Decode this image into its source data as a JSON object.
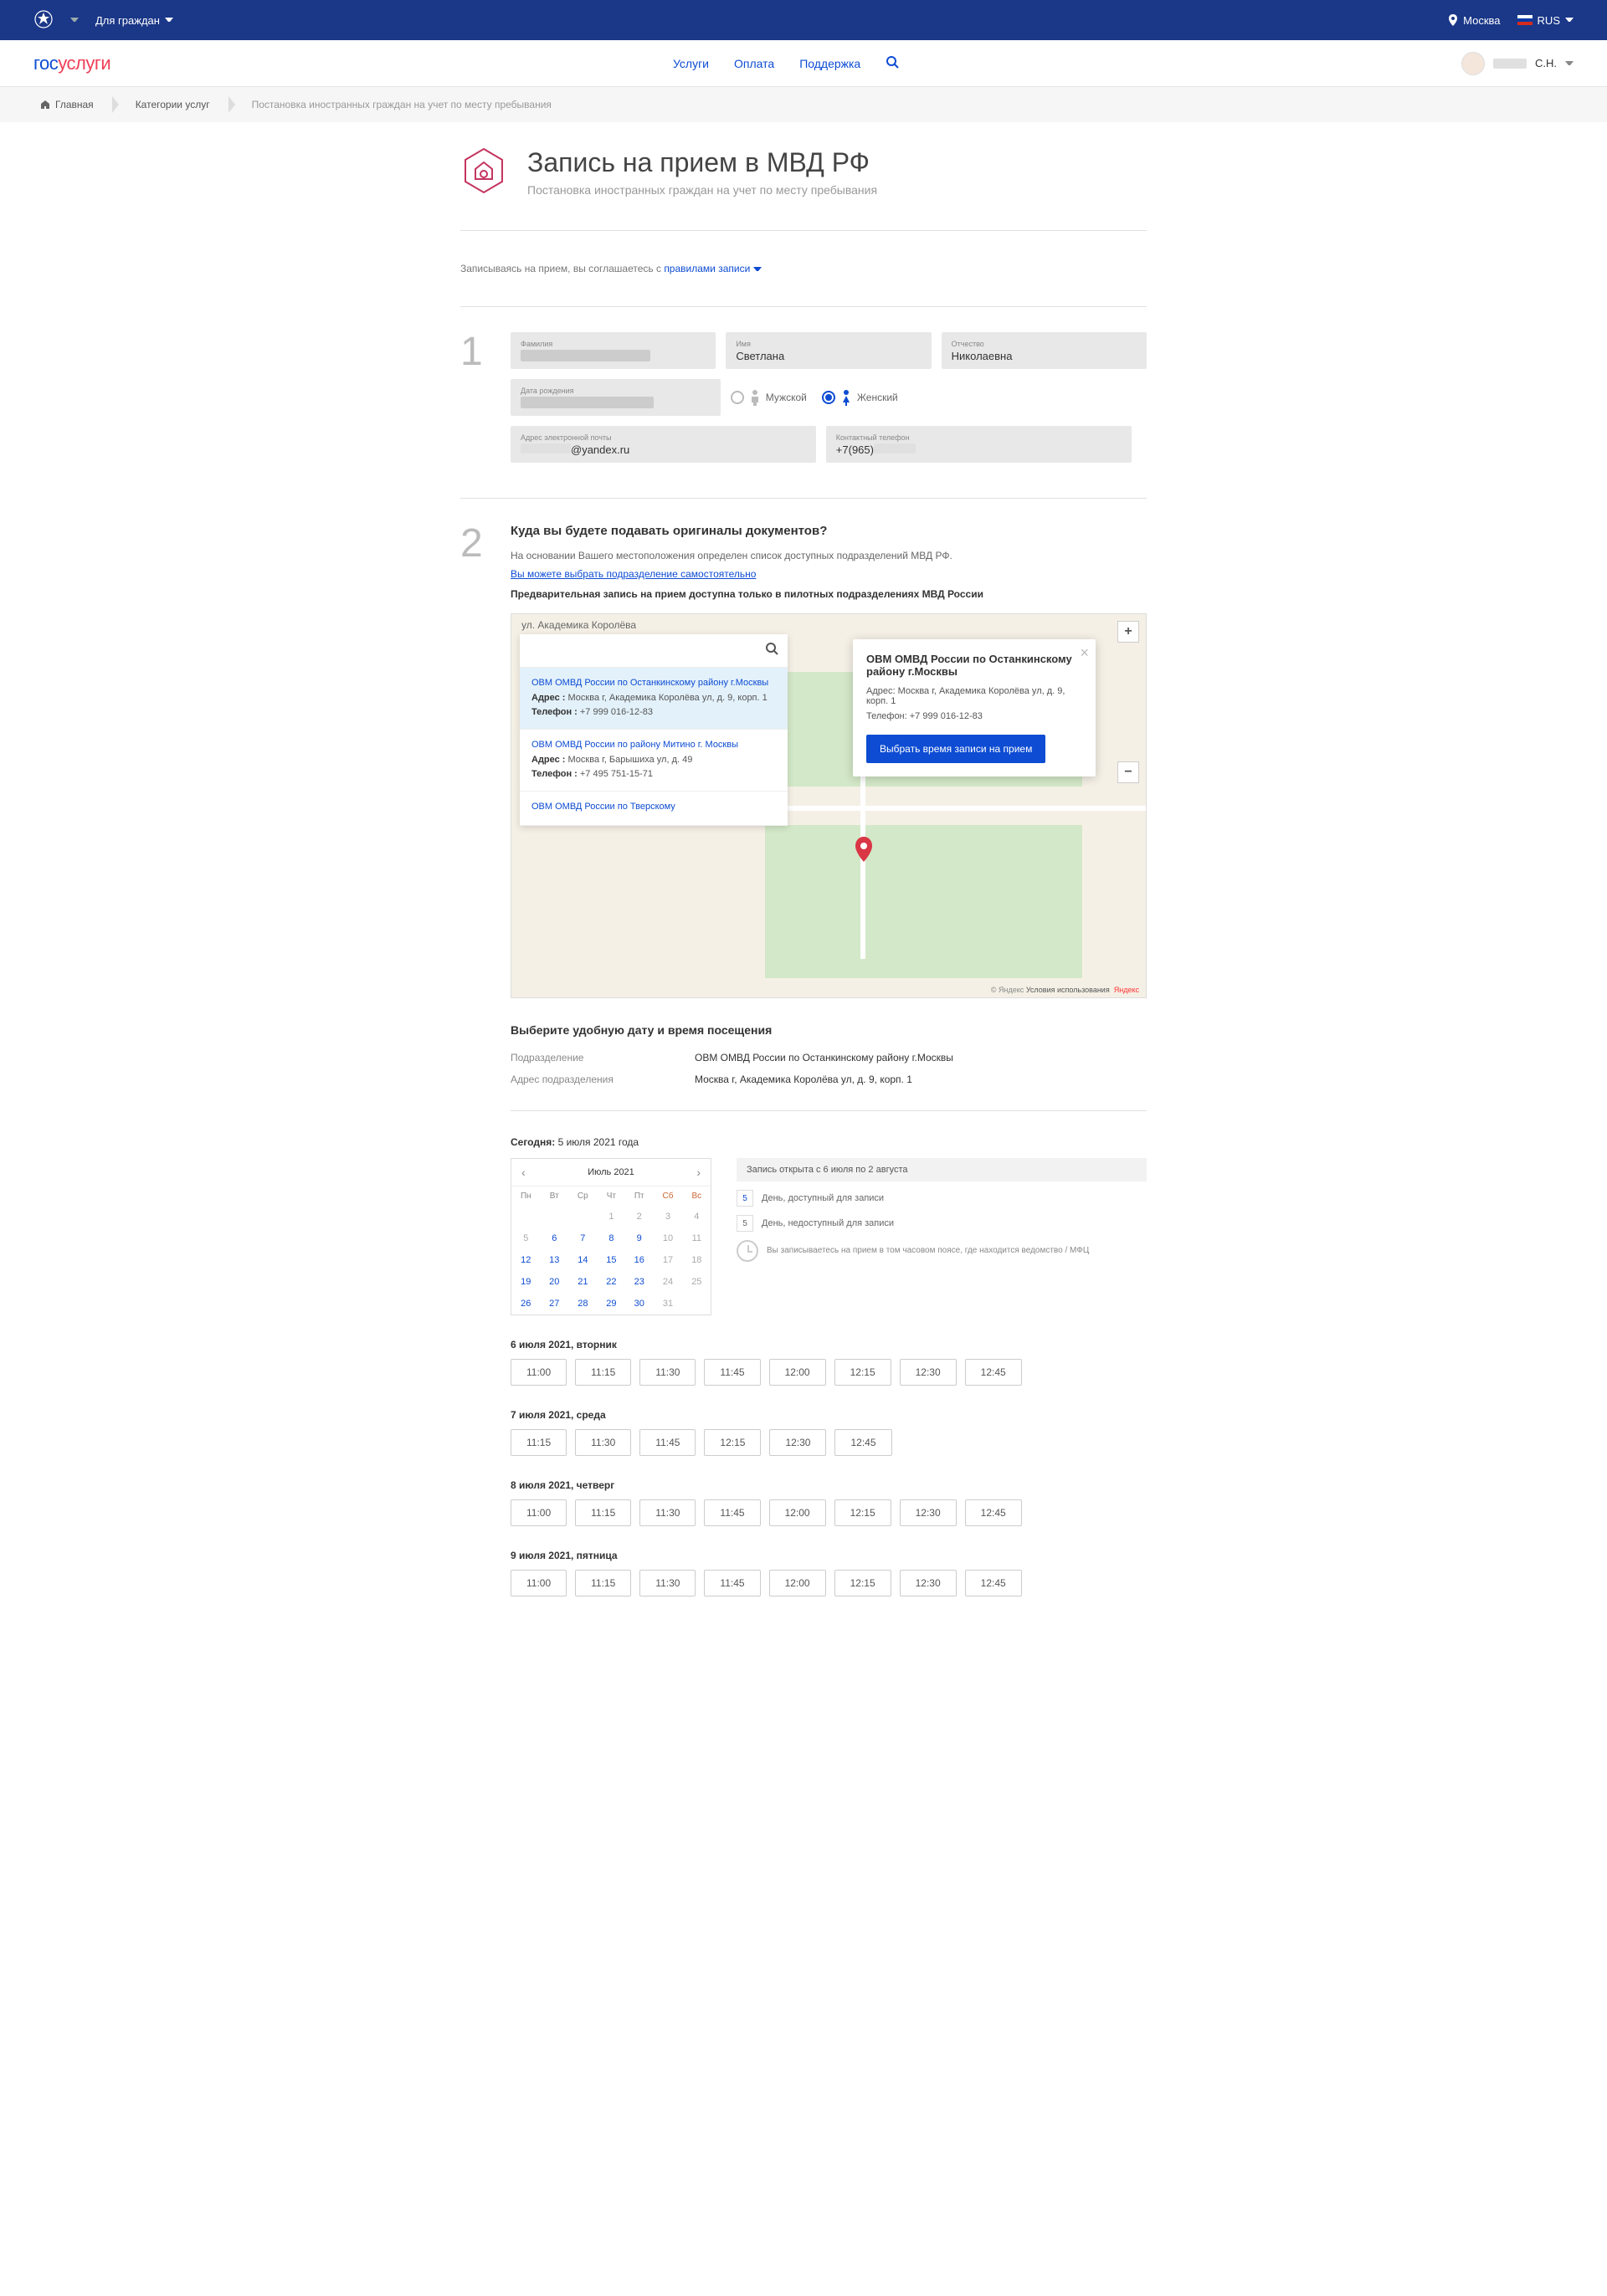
{
  "topbar": {
    "audience": "Для граждан",
    "city": "Москва",
    "lang": "RUS"
  },
  "nav": {
    "logo_a": "гос",
    "logo_b": "услуги",
    "items": [
      "Услуги",
      "Оплата",
      "Поддержка"
    ],
    "user_initials": "С.Н."
  },
  "breadcrumb": {
    "home": "Главная",
    "cat": "Категории услуг",
    "page": "Постановка иностранных граждан на учет по месту пребывания"
  },
  "head": {
    "title": "Запись на прием в МВД РФ",
    "subtitle": "Постановка иностранных граждан на учет по месту пребывания"
  },
  "rules": {
    "pre": "Записываясь на прием, вы соглашаетесь с ",
    "link": "правилами записи"
  },
  "step1": {
    "labels": {
      "surname": "Фамилия",
      "name": "Имя",
      "patronymic": "Отчество",
      "dob": "Дата рождения",
      "email": "Адрес электронной почты",
      "phone": "Контактный телефон",
      "male": "Мужской",
      "female": "Женский"
    },
    "name": "Светлана",
    "patronymic": "Николаевна",
    "email_suffix": "@yandex.ru",
    "phone_prefix": "+7(965)"
  },
  "step2": {
    "heading": "Куда вы будете подавать оригиналы документов?",
    "text1": "На основании Вашего местоположения определен список доступных подразделений МВД РФ.",
    "link": "Вы можете выбрать подразделение самостоятельно",
    "text_bold": "Предварительная запись на прием доступна только в пилотных подразделениях МВД России",
    "street": "ул. Академика Королёва",
    "offices": [
      {
        "name": "ОВМ ОМВД России по Останкинскому району г.Москвы",
        "addr": "Москва г, Академика Королёва ул, д. 9, корп. 1",
        "phone": "+7 999 016-12-83",
        "sel": true
      },
      {
        "name": "ОВМ ОМВД России по району Митино г. Москвы",
        "addr": "Москва г, Барышиха ул, д. 49",
        "phone": "+7 495 751-15-71",
        "sel": false
      },
      {
        "name": "ОВМ ОМВД России по Тверскому",
        "addr": "",
        "phone": "",
        "sel": false
      }
    ],
    "popup": {
      "title": "ОВМ ОМВД России по Останкинскому району г.Москвы",
      "addr_lbl": "Адрес: ",
      "addr": "Москва г, Академика Королёва ул, д. 9, корп. 1",
      "phone_lbl": "Телефон: ",
      "phone": "+7 999 016-12-83",
      "btn": "Выбрать время записи на прием"
    },
    "addr_word": "Адрес : ",
    "phone_word": "Телефон : ",
    "map_credit": "© Яндекс ",
    "map_terms": "Условия использования",
    "map_yandex": "Яндекс"
  },
  "selection": {
    "title": "Выберите удобную дату и время посещения",
    "dept_lbl": "Подразделение",
    "dept": "ОВМ ОМВД России по Останкинскому району г.Москвы",
    "addr_lbl": "Адрес подразделения",
    "addr": "Москва г, Академика Королёва ул, д. 9, корп. 1"
  },
  "today_lbl": "Сегодня: ",
  "today_val": "5 июля 2021 года",
  "calendar": {
    "month": "Июль 2021",
    "dow": [
      "Пн",
      "Вт",
      "Ср",
      "Чт",
      "Пт",
      "Сб",
      "Вс"
    ],
    "weeks": [
      [
        {
          "d": "",
          "a": 0
        },
        {
          "d": "",
          "a": 0
        },
        {
          "d": "",
          "a": 0
        },
        {
          "d": "1",
          "a": 0
        },
        {
          "d": "2",
          "a": 0
        },
        {
          "d": "3",
          "a": 0
        },
        {
          "d": "4",
          "a": 0
        }
      ],
      [
        {
          "d": "5",
          "a": 0
        },
        {
          "d": "6",
          "a": 1
        },
        {
          "d": "7",
          "a": 1
        },
        {
          "d": "8",
          "a": 1
        },
        {
          "d": "9",
          "a": 1
        },
        {
          "d": "10",
          "a": 0
        },
        {
          "d": "11",
          "a": 0
        }
      ],
      [
        {
          "d": "12",
          "a": 1
        },
        {
          "d": "13",
          "a": 1
        },
        {
          "d": "14",
          "a": 1
        },
        {
          "d": "15",
          "a": 1
        },
        {
          "d": "16",
          "a": 1
        },
        {
          "d": "17",
          "a": 0
        },
        {
          "d": "18",
          "a": 0
        }
      ],
      [
        {
          "d": "19",
          "a": 1
        },
        {
          "d": "20",
          "a": 1
        },
        {
          "d": "21",
          "a": 1
        },
        {
          "d": "22",
          "a": 1
        },
        {
          "d": "23",
          "a": 1
        },
        {
          "d": "24",
          "a": 0
        },
        {
          "d": "25",
          "a": 0
        }
      ],
      [
        {
          "d": "26",
          "a": 1
        },
        {
          "d": "27",
          "a": 1
        },
        {
          "d": "28",
          "a": 1
        },
        {
          "d": "29",
          "a": 1
        },
        {
          "d": "30",
          "a": 1
        },
        {
          "d": "31",
          "a": 0
        },
        {
          "d": "",
          "a": 0
        }
      ]
    ]
  },
  "legend": {
    "title": "Запись открыта с 6 июля по 2 августа",
    "avail": "День, доступный для записи",
    "navail": "День, недоступный для записи",
    "sample": "5",
    "tz": "Вы записываетесь на прием в том часовом поясе, где находится ведомство / МФЦ"
  },
  "slots": [
    {
      "date": "6 июля 2021, вторник",
      "times": [
        "11:00",
        "11:15",
        "11:30",
        "11:45",
        "12:00",
        "12:15",
        "12:30",
        "12:45"
      ]
    },
    {
      "date": "7 июля 2021, среда",
      "times": [
        "11:15",
        "11:30",
        "11:45",
        "12:15",
        "12:30",
        "12:45"
      ]
    },
    {
      "date": "8 июля 2021, четверг",
      "times": [
        "11:00",
        "11:15",
        "11:30",
        "11:45",
        "12:00",
        "12:15",
        "12:30",
        "12:45"
      ]
    },
    {
      "date": "9 июля 2021, пятница",
      "times": [
        "11:00",
        "11:15",
        "11:30",
        "11:45",
        "12:00",
        "12:15",
        "12:30",
        "12:45"
      ]
    }
  ]
}
